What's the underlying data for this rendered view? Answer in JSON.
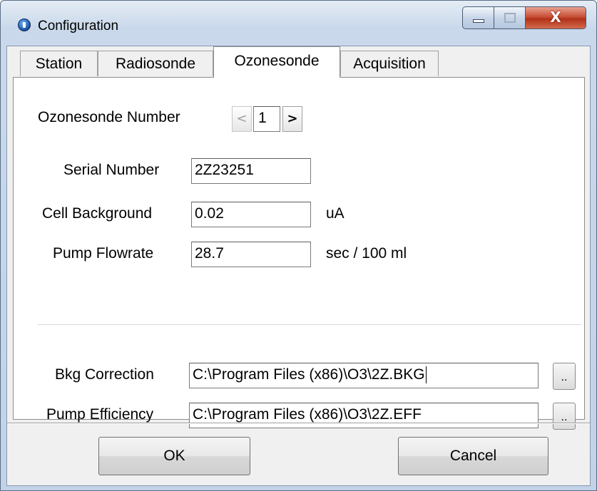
{
  "window": {
    "title": "Configuration",
    "close_glyph": "X"
  },
  "tabs": [
    {
      "label": "Station"
    },
    {
      "label": "Radiosonde"
    },
    {
      "label": "Ozonesonde",
      "active": true
    },
    {
      "label": "Acquisition"
    }
  ],
  "ozonesonde": {
    "number_label": "Ozonesonde Number",
    "number_prev": "<",
    "number_value": "1",
    "number_next": ">",
    "serial_label": "Serial Number",
    "serial_value": "2Z23251",
    "cell_bg_label": "Cell Background",
    "cell_bg_value": "0.02",
    "cell_bg_unit": "uA",
    "flowrate_label": "Pump Flowrate",
    "flowrate_value": "28.7",
    "flowrate_unit": "sec / 100 ml",
    "bkg_label": "Bkg Correction",
    "bkg_value": "C:\\Program Files (x86)\\O3\\2Z.BKG",
    "bkg_browse": "..",
    "eff_label": "Pump Efficiency",
    "eff_value": "C:\\Program Files (x86)\\O3\\2Z.EFF",
    "eff_browse": ".."
  },
  "buttons": {
    "ok": "OK",
    "cancel": "Cancel"
  },
  "icons": {
    "app": "info-app-icon",
    "minimize": "minimize-icon",
    "maximize": "maximize-icon",
    "close": "close-icon"
  },
  "colors": {
    "close_button": "#c75038",
    "title_gradient": "#c9d8ea"
  }
}
